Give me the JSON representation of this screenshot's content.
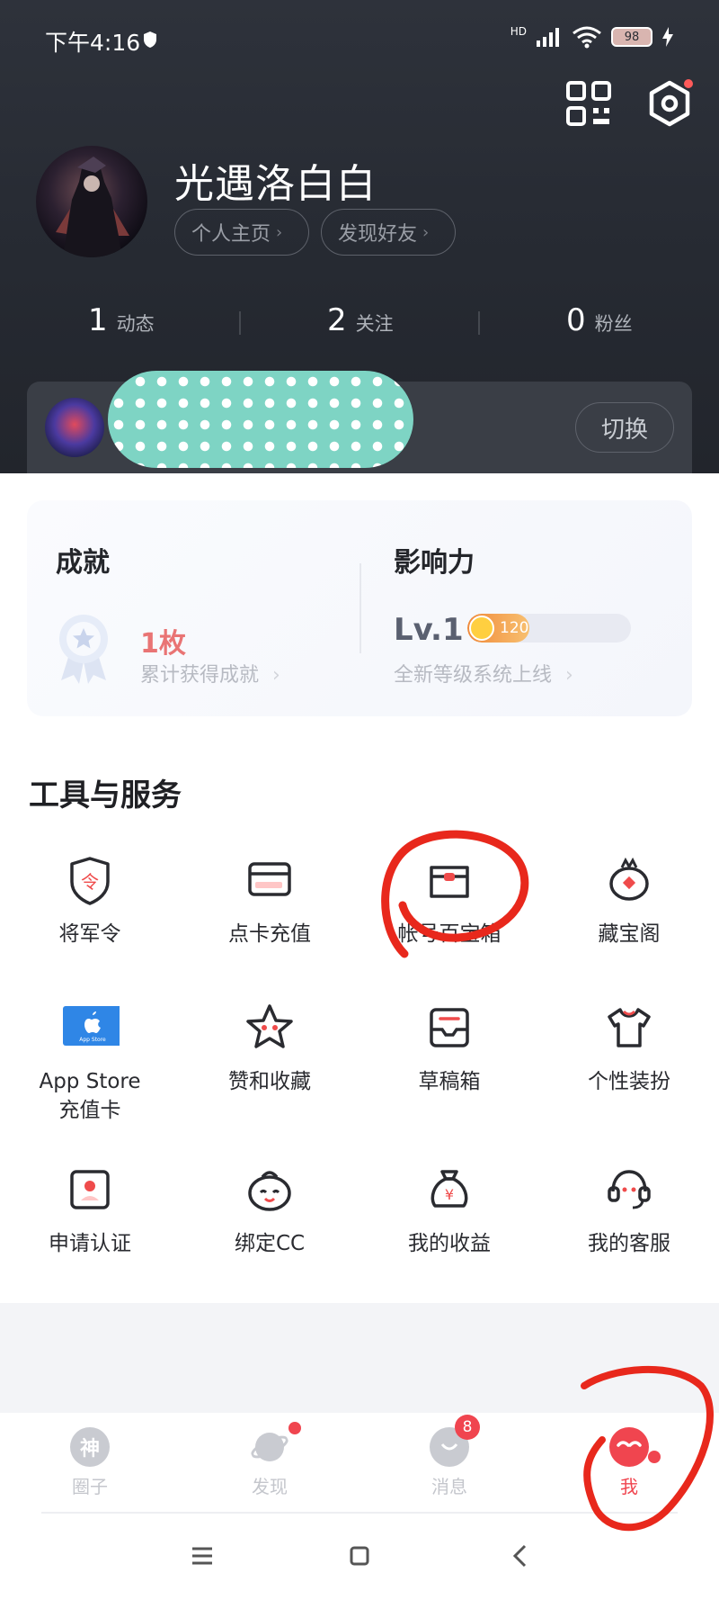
{
  "status_bar": {
    "time": "下午4:16",
    "network": "HD",
    "battery": "98"
  },
  "profile": {
    "username": "光遇洛白白",
    "home_label": "个人主页",
    "friends_label": "发现好友",
    "stats": [
      {
        "count": "1",
        "label": "动态"
      },
      {
        "count": "2",
        "label": "关注"
      },
      {
        "count": "0",
        "label": "粉丝"
      }
    ],
    "switch_label": "切换"
  },
  "achievements": {
    "title": "成就",
    "count": "1枚",
    "sub": "累计获得成就",
    "influence_title": "影响力",
    "level": "Lv.1",
    "xp": "120",
    "xp_progress": 0.38,
    "influence_sub": "全新等级系统上线"
  },
  "tools": {
    "title": "工具与服务",
    "items": [
      {
        "label": "将军令",
        "icon": "shield-token-icon"
      },
      {
        "label": "点卡充值",
        "icon": "card-icon"
      },
      {
        "label": "帐号百宝箱",
        "icon": "toolbox-icon"
      },
      {
        "label": "藏宝阁",
        "icon": "treasure-bird-icon"
      },
      {
        "label": "App Store\n充值卡",
        "icon": "app-store-icon",
        "badge_text": "App Store"
      },
      {
        "label": "赞和收藏",
        "icon": "star-icon"
      },
      {
        "label": "草稿箱",
        "icon": "draft-box-icon"
      },
      {
        "label": "个性装扮",
        "icon": "tshirt-icon"
      },
      {
        "label": "申请认证",
        "icon": "certification-icon"
      },
      {
        "label": "绑定CC",
        "icon": "cc-bind-icon"
      },
      {
        "label": "我的收益",
        "icon": "money-bag-icon",
        "symbol": "¥"
      },
      {
        "label": "我的客服",
        "icon": "headset-icon"
      }
    ]
  },
  "tabbar": {
    "tabs": [
      {
        "label": "圈子",
        "icon_text": "神"
      },
      {
        "label": "发现"
      },
      {
        "label": "消息",
        "badge": "8"
      },
      {
        "label": "我"
      }
    ]
  },
  "colors": {
    "accent": "#f0454f",
    "dark_header": "#2a2e36",
    "achievement_red": "#e97474"
  }
}
